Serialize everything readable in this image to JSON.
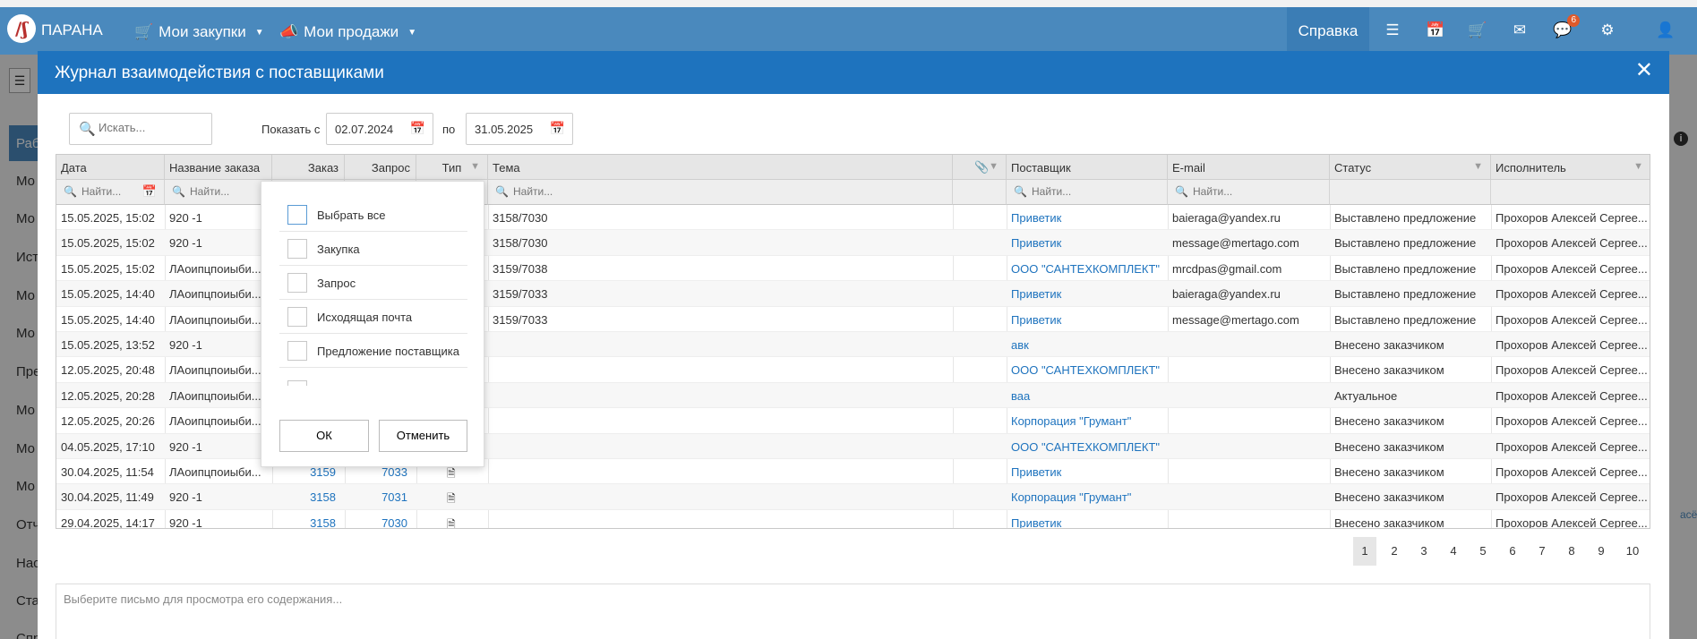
{
  "navbar": {
    "logo": "/ʃ",
    "brand": "ПАРАНА",
    "menu_purchases": "Мои закупки",
    "menu_sales": "Мои продажи",
    "help": "Справка",
    "notification_count": "6",
    "icons": [
      "list-icon",
      "calendar-icon",
      "cart-icon",
      "envelope-icon",
      "chat-icon",
      "sitemap-icon",
      "user-icon"
    ]
  },
  "background": {
    "sidebar_labels": [
      "Раб",
      "Мо",
      "Мо",
      "Ист",
      "Мо",
      "Мо",
      "Пре",
      "Мо",
      "Мо",
      "Мо",
      "Отч",
      "Нас",
      "Ста",
      "Спр"
    ],
    "right_link_fragment": "асё"
  },
  "modal": {
    "title": "Журнал взаимодействия с поставщиками",
    "close_symbol": "✕",
    "search_placeholder": "Искать...",
    "show_from_label": "Показать с",
    "date_from": "02.07.2024",
    "to_label": "по",
    "date_to": "31.05.2025"
  },
  "grid": {
    "columns": {
      "date": "Дата",
      "order_name": "Название заказа",
      "order": "Заказ",
      "request": "Запрос",
      "type": "Тип",
      "topic": "Тема",
      "supplier": "Поставщик",
      "email": "E-mail",
      "status": "Статус",
      "executor": "Исполнитель"
    },
    "filter_placeholder": "Найти...",
    "rows": [
      {
        "date": "15.05.2025, 15:02",
        "name": "920 -1",
        "order": "",
        "request": "",
        "topic": "3158/7030",
        "supplier": "Приветик",
        "email": "baieraga@yandex.ru",
        "status": "Выставлено предложение",
        "executor": "Прохоров Алексей Сергее..."
      },
      {
        "date": "15.05.2025, 15:02",
        "name": "920 -1",
        "order": "",
        "request": "",
        "topic": "3158/7030",
        "supplier": "Приветик",
        "email": "message@mertago.com",
        "status": "Выставлено предложение",
        "executor": "Прохоров Алексей Сергее..."
      },
      {
        "date": "15.05.2025, 15:02",
        "name": "ЛАоипцпоиыби...",
        "order": "",
        "request": "",
        "topic": "3159/7038",
        "supplier": "ООО \"САНТЕХКОМПЛЕКТ\"",
        "email": "mrcdpas@gmail.com",
        "status": "Выставлено предложение",
        "executor": "Прохоров Алексей Сергее..."
      },
      {
        "date": "15.05.2025, 14:40",
        "name": "ЛАоипцпоиыби...",
        "order": "",
        "request": "",
        "topic": "3159/7033",
        "supplier": "Приветик",
        "email": "baieraga@yandex.ru",
        "status": "Выставлено предложение",
        "executor": "Прохоров Алексей Сергее..."
      },
      {
        "date": "15.05.2025, 14:40",
        "name": "ЛАоипцпоиыби...",
        "order": "",
        "request": "",
        "topic": "3159/7033",
        "supplier": "Приветик",
        "email": "message@mertago.com",
        "status": "Выставлено предложение",
        "executor": "Прохоров Алексей Сергее..."
      },
      {
        "date": "15.05.2025, 13:52",
        "name": "920 -1",
        "order": "",
        "request": "",
        "topic": "",
        "supplier": "авк",
        "email": "",
        "status": "Внесено заказчиком",
        "executor": "Прохоров Алексей Сергее..."
      },
      {
        "date": "12.05.2025, 20:48",
        "name": "ЛАоипцпоиыби...",
        "order": "",
        "request": "",
        "topic": "",
        "supplier": "ООО \"САНТЕХКОМПЛЕКТ\"",
        "email": "",
        "status": "Внесено заказчиком",
        "executor": "Прохоров Алексей Сергее..."
      },
      {
        "date": "12.05.2025, 20:28",
        "name": "ЛАоипцпоиыби...",
        "order": "",
        "request": "",
        "topic": "",
        "supplier": "ваа",
        "email": "",
        "status": "Актуальное",
        "executor": "Прохоров Алексей Сергее..."
      },
      {
        "date": "12.05.2025, 20:26",
        "name": "ЛАоипцпоиыби...",
        "order": "",
        "request": "",
        "topic": "",
        "supplier": "Корпорация \"Грумант\"",
        "email": "",
        "status": "Внесено заказчиком",
        "executor": "Прохоров Алексей Сергее..."
      },
      {
        "date": "04.05.2025, 17:10",
        "name": "920 -1",
        "order": "",
        "request": "",
        "topic": "",
        "supplier": "ООО \"САНТЕХКОМПЛЕКТ\"",
        "email": "",
        "status": "Внесено заказчиком",
        "executor": "Прохоров Алексей Сергее..."
      },
      {
        "date": "30.04.2025, 11:54",
        "name": "ЛАоипцпоиыби...",
        "order": "3159",
        "request": "7033",
        "topic": "",
        "supplier": "Приветик",
        "email": "",
        "status": "Внесено заказчиком",
        "executor": "Прохоров Алексей Сергее..."
      },
      {
        "date": "30.04.2025, 11:49",
        "name": "920 -1",
        "order": "3158",
        "request": "7031",
        "topic": "",
        "supplier": "Корпорация \"Грумант\"",
        "email": "",
        "status": "Внесено заказчиком",
        "executor": "Прохоров Алексей Сергее..."
      },
      {
        "date": "29.04.2025, 14:17",
        "name": "920 -1",
        "order": "3158",
        "request": "7030",
        "topic": "",
        "supplier": "Приветик",
        "email": "",
        "status": "Внесено заказчиком",
        "executor": "Прохоров Алексей Сергее..."
      }
    ]
  },
  "type_filter": {
    "options": [
      "Выбрать все",
      "Закупка",
      "Запрос",
      "Исходящая почта",
      "Предложение поставщика"
    ],
    "ok": "ОК",
    "cancel": "Отменить"
  },
  "pagination": {
    "pages": [
      "1",
      "2",
      "3",
      "4",
      "5",
      "6",
      "7",
      "8",
      "9",
      "10"
    ],
    "current": "1"
  },
  "preview_placeholder": "Выберите письмо для просмотра его содержания...",
  "colors": {
    "navbar": "#4a89bd",
    "modal_header": "#1e73be",
    "link": "#1e73be",
    "badge": "#e05a2b"
  }
}
